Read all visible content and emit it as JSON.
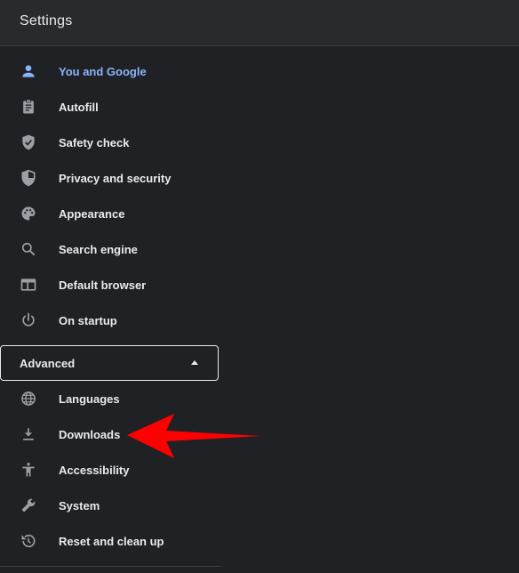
{
  "header": {
    "title": "Settings"
  },
  "nav": {
    "items": [
      {
        "label": "You and Google",
        "icon": "person-icon",
        "active": true
      },
      {
        "label": "Autofill",
        "icon": "clipboard-icon"
      },
      {
        "label": "Safety check",
        "icon": "shield-check-icon"
      },
      {
        "label": "Privacy and security",
        "icon": "shield-half-icon"
      },
      {
        "label": "Appearance",
        "icon": "palette-icon"
      },
      {
        "label": "Search engine",
        "icon": "search-icon"
      },
      {
        "label": "Default browser",
        "icon": "browser-window-icon"
      },
      {
        "label": "On startup",
        "icon": "power-icon"
      }
    ],
    "advanced": {
      "label": "Advanced",
      "expanded": true
    },
    "advanced_items": [
      {
        "label": "Languages",
        "icon": "globe-icon"
      },
      {
        "label": "Downloads",
        "icon": "download-icon"
      },
      {
        "label": "Accessibility",
        "icon": "accessibility-icon"
      },
      {
        "label": "System",
        "icon": "wrench-icon"
      },
      {
        "label": "Reset and clean up",
        "icon": "restore-icon"
      }
    ]
  },
  "colors": {
    "background": "#202124",
    "header_bg": "#292a2d",
    "text": "#e8eaed",
    "active": "#8ab4f8",
    "icon": "#9aa0a6",
    "annotation_arrow": "#ff0000"
  }
}
